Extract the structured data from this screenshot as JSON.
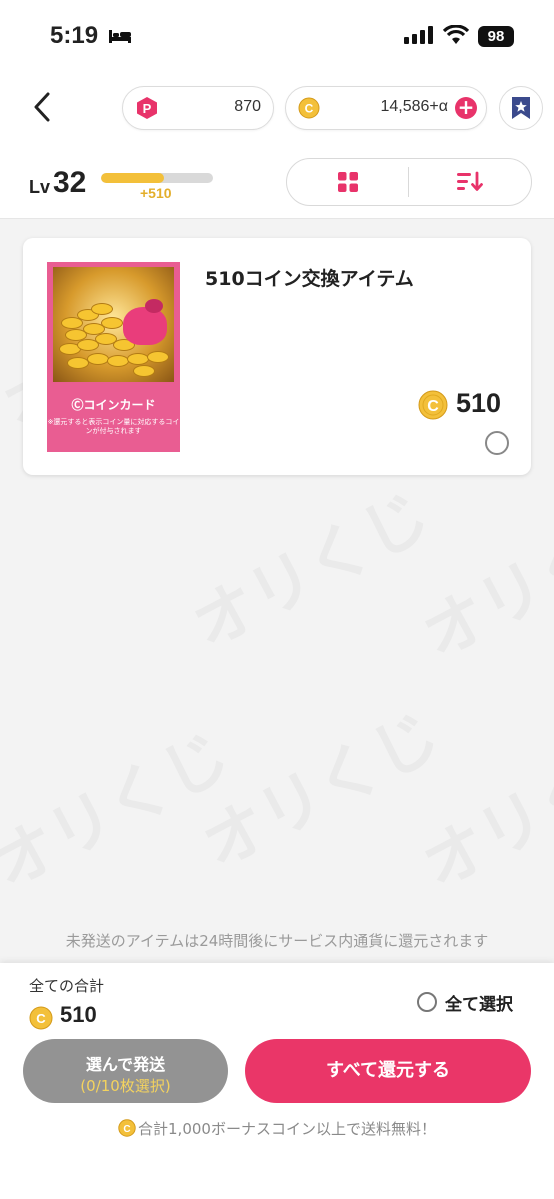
{
  "status_bar": {
    "time": "5:19",
    "battery": "98"
  },
  "header": {
    "points": "870",
    "coins": "14,586+α",
    "level_prefix": "Lv",
    "level": "32",
    "xp_gain": "+510",
    "xp_progress": 0.56
  },
  "item": {
    "title": "510コイン交換アイテム",
    "card_label": "Ⓒコインカード",
    "card_note": "※還元すると表示コイン量に対応するコインが付与されます",
    "price": "510"
  },
  "watermark_text": "オリくじ",
  "notice": "未発送のアイテムは24時間後にサービス内通貨に還元されます",
  "footer": {
    "total_label": "全ての合計",
    "total_value": "510",
    "select_all": "全て選択",
    "send_button": "選んで発送",
    "send_count": "(0/10枚選択)",
    "return_button": "すべて還元する",
    "bonus_note": "合計1,000ボーナスコイン以上で送料無料！"
  },
  "colors": {
    "accent": "#ea3668",
    "coin": "#f3c03a",
    "xp_bar": "#f3c03a"
  }
}
